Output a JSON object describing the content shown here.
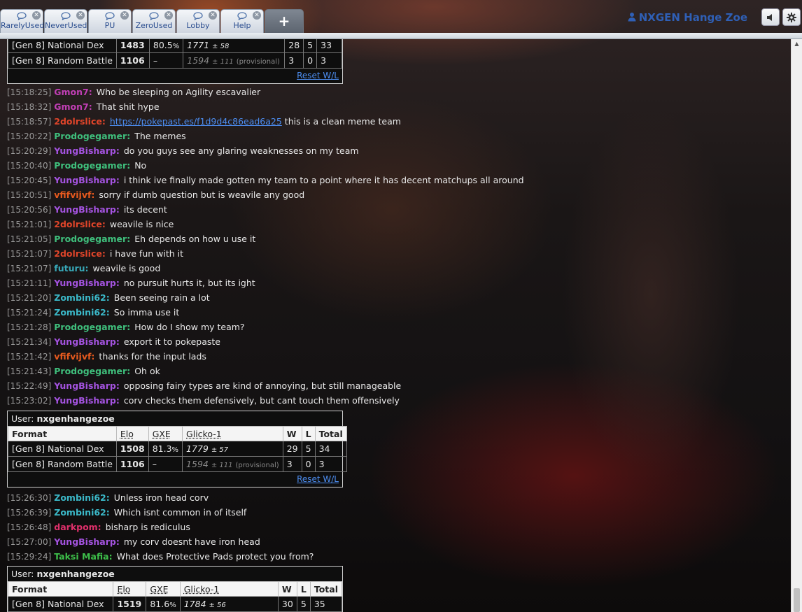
{
  "tabs": [
    {
      "label": "RarelyUsed"
    },
    {
      "label": "NeverUsed"
    },
    {
      "label": "PU"
    },
    {
      "label": "ZeroUsed"
    },
    {
      "label": "Lobby"
    },
    {
      "label": "Help"
    }
  ],
  "add_tab_label": "+",
  "user": {
    "name": "NXGEN Hange Zoe"
  },
  "colors": {
    "Gmon7": "#c23fb6",
    "2dolrslice": "#e0452a",
    "Prodogegamer": "#3fbf7c",
    "YungBisharp": "#a453e0",
    "vfifvijvf": "#e85a1e",
    "futuru": "#38a8b8",
    "Zombini62": "#3bb8c8",
    "darkpom": "#e0306b",
    "Taksi Mafia": "#3dbf4a"
  },
  "rank_tables": [
    {
      "user_label": "",
      "username": "",
      "rows": [
        {
          "format": "[Gen 8] National Dex",
          "elo": "1483",
          "gxe": "80.5",
          "gxe_unit": "%",
          "glicko": "1771",
          "glicko_dev": "± 58",
          "glicko_note": "",
          "w": "28",
          "l": "5",
          "total": "33"
        },
        {
          "format": "[Gen 8] Random Battle",
          "elo": "1106",
          "gxe": "–",
          "gxe_unit": "",
          "glicko": "1594",
          "glicko_dev": "± 111",
          "glicko_note": "(provisional)",
          "w": "3",
          "l": "0",
          "total": "3"
        }
      ],
      "reset": "Reset W/L"
    },
    {
      "user_label": "User:",
      "username": "nxgenhangezoe",
      "headers": [
        "Format",
        "Elo",
        "GXE",
        "Glicko-1",
        "W",
        "L",
        "Total"
      ],
      "rows": [
        {
          "format": "[Gen 8] National Dex",
          "elo": "1508",
          "gxe": "81.3",
          "gxe_unit": "%",
          "glicko": "1779",
          "glicko_dev": "± 57",
          "glicko_note": "",
          "w": "29",
          "l": "5",
          "total": "34"
        },
        {
          "format": "[Gen 8] Random Battle",
          "elo": "1106",
          "gxe": "–",
          "gxe_unit": "",
          "glicko": "1594",
          "glicko_dev": "± 111",
          "glicko_note": "(provisional)",
          "w": "3",
          "l": "0",
          "total": "3"
        }
      ],
      "reset": "Reset W/L"
    },
    {
      "user_label": "User:",
      "username": "nxgenhangezoe",
      "headers": [
        "Format",
        "Elo",
        "GXE",
        "Glicko-1",
        "W",
        "L",
        "Total"
      ],
      "rows": [
        {
          "format": "[Gen 8] National Dex",
          "elo": "1519",
          "gxe": "81.6",
          "gxe_unit": "%",
          "glicko": "1784",
          "glicko_dev": "± 56",
          "glicko_note": "",
          "w": "30",
          "l": "5",
          "total": "35"
        }
      ],
      "reset": ""
    }
  ],
  "messages_a": [
    {
      "time": "[15:18:25]",
      "user": "Gmon7:",
      "text": "Who be sleeping on Agility escavalier"
    },
    {
      "time": "[15:18:32]",
      "user": "Gmon7:",
      "text": "That shit hype"
    },
    {
      "time": "[15:18:57]",
      "user": "2dolrslice:",
      "link": "https://pokepast.es/f1d9d4c86ead6a25",
      "text": " this is a clean meme team"
    },
    {
      "time": "[15:20:22]",
      "user": "Prodogegamer:",
      "text": "The memes"
    },
    {
      "time": "[15:20:29]",
      "user": "YungBisharp:",
      "text": "do you guys see any glaring weaknesses on my team"
    },
    {
      "time": "[15:20:40]",
      "user": "Prodogegamer:",
      "text": "No"
    },
    {
      "time": "[15:20:45]",
      "user": "YungBisharp:",
      "text": "i think ive finally made gotten my team to a point where it has decent matchups all around"
    },
    {
      "time": "[15:20:51]",
      "user": "vfifvijvf:",
      "text": "sorry if dumb question but is weavile any good"
    },
    {
      "time": "[15:20:56]",
      "user": "YungBisharp:",
      "text": "its decent"
    },
    {
      "time": "[15:21:01]",
      "user": "2dolrslice:",
      "text": "weavile is nice"
    },
    {
      "time": "[15:21:05]",
      "user": "Prodogegamer:",
      "text": "Eh depends on how u use it"
    },
    {
      "time": "[15:21:07]",
      "user": "2dolrslice:",
      "text": "i have fun with it"
    },
    {
      "time": "[15:21:07]",
      "user": "futuru:",
      "text": "weavile is good"
    },
    {
      "time": "[15:21:11]",
      "user": "YungBisharp:",
      "text": "no pursuit hurts it, but its ight"
    },
    {
      "time": "[15:21:20]",
      "user": "Zombini62:",
      "text": "Been seeing rain a lot"
    },
    {
      "time": "[15:21:24]",
      "user": "Zombini62:",
      "text": "So imma use it"
    },
    {
      "time": "[15:21:28]",
      "user": "Prodogegamer:",
      "text": "How do I show my team?"
    },
    {
      "time": "[15:21:34]",
      "user": "YungBisharp:",
      "text": "export it to pokepaste"
    },
    {
      "time": "[15:21:42]",
      "user": "vfifvijvf:",
      "text": "thanks for the input lads"
    },
    {
      "time": "[15:21:43]",
      "user": "Prodogegamer:",
      "text": "Oh ok"
    },
    {
      "time": "[15:22:49]",
      "user": "YungBisharp:",
      "text": "opposing fairy types are kind of annoying, but still manageable"
    },
    {
      "time": "[15:23:02]",
      "user": "YungBisharp:",
      "text": "corv checks them defensively, but cant touch them offensively"
    }
  ],
  "messages_b": [
    {
      "time": "[15:26:30]",
      "user": "Zombini62:",
      "text": "Unless iron head corv"
    },
    {
      "time": "[15:26:39]",
      "user": "Zombini62:",
      "text": "Which isnt common in of itself"
    },
    {
      "time": "[15:26:48]",
      "user": "darkpom:",
      "text": "bisharp is rediculus"
    },
    {
      "time": "[15:27:00]",
      "user": "YungBisharp:",
      "text": "my corv doesnt have iron head"
    },
    {
      "time": "[15:29:24]",
      "user": "Taksi Mafia:",
      "text": "What does Protective Pads protect you from?"
    }
  ]
}
